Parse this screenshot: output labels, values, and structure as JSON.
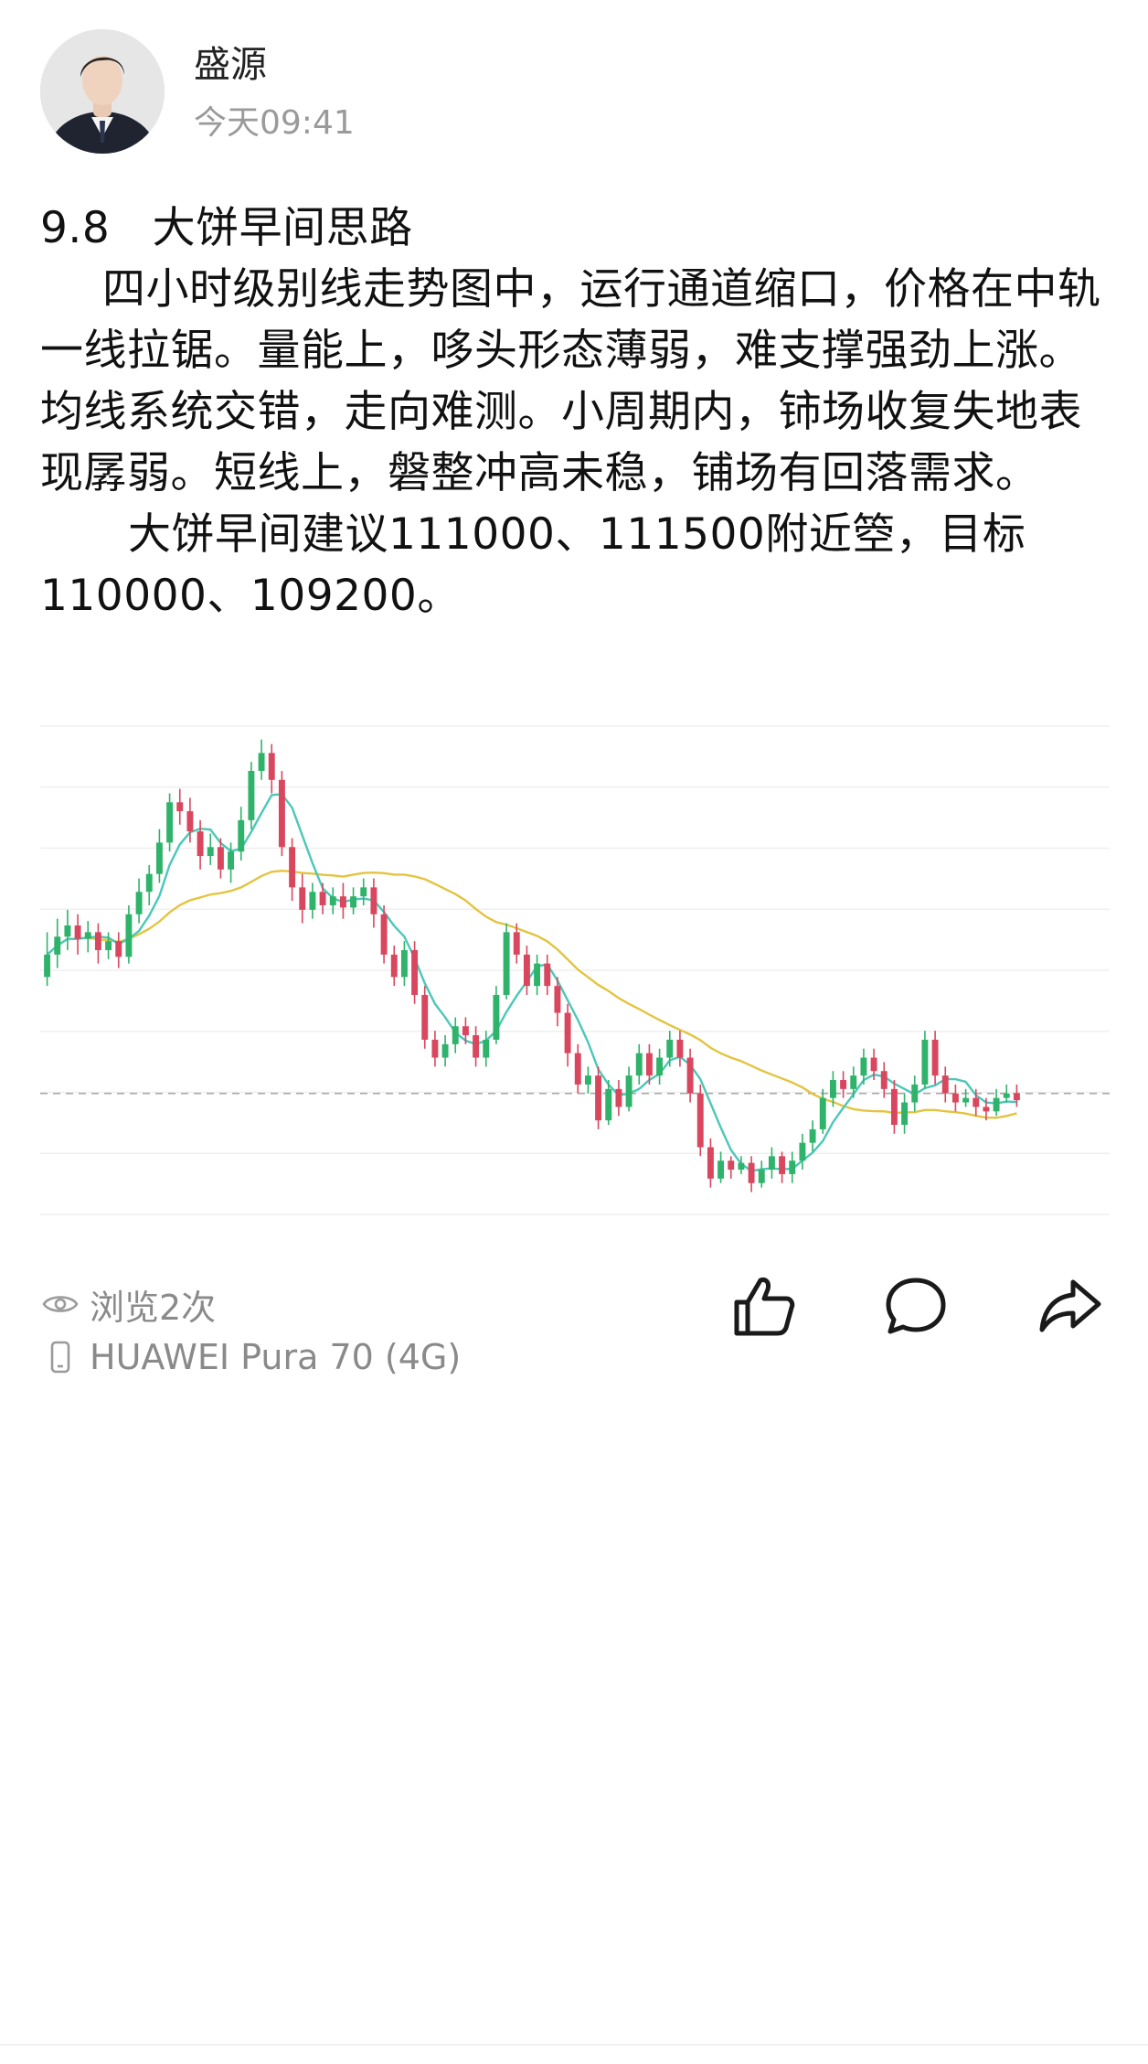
{
  "author": {
    "name": "盛源",
    "time": "今天09:41"
  },
  "post": {
    "title": "9.8   大饼早间思路",
    "paragraph1": "四小时级别线走势图中，运行通道缩口，价格在中轨一线拉锯。量能上，哆头形态薄弱，难支撑强劲上涨。均线系统交错，走向难测。小周期内，铈场收复失地表现孱弱。短线上，磐整冲高未稳，铺场有回落需求。",
    "paragraph2": "大饼早间建议111000、111500附近箜，目标110000、109200。"
  },
  "chart_data": {
    "type": "candlestick",
    "colors": {
      "up": "#2fb36b",
      "down": "#d9475f",
      "ma_short": "#4cc7b8",
      "ma_long": "#e3c440",
      "price_line": "#aaaaaa",
      "grid": "#efefef"
    },
    "grid": true,
    "candles": [
      [
        140,
        150,
        160,
        136
      ],
      [
        150,
        158,
        166,
        144
      ],
      [
        158,
        163,
        170,
        152
      ],
      [
        163,
        157,
        168,
        150
      ],
      [
        157,
        160,
        165,
        151
      ],
      [
        160,
        152,
        164,
        146
      ],
      [
        152,
        156,
        160,
        148
      ],
      [
        156,
        149,
        160,
        144
      ],
      [
        149,
        168,
        172,
        146
      ],
      [
        168,
        178,
        184,
        164
      ],
      [
        178,
        186,
        190,
        172
      ],
      [
        186,
        200,
        206,
        182
      ],
      [
        200,
        218,
        222,
        196
      ],
      [
        218,
        214,
        224,
        208
      ],
      [
        214,
        205,
        220,
        200
      ],
      [
        205,
        194,
        210,
        188
      ],
      [
        194,
        198,
        204,
        190
      ],
      [
        198,
        188,
        202,
        184
      ],
      [
        188,
        196,
        200,
        182
      ],
      [
        196,
        210,
        216,
        192
      ],
      [
        210,
        232,
        236,
        206
      ],
      [
        232,
        240,
        246,
        228
      ],
      [
        240,
        228,
        244,
        222
      ],
      [
        228,
        198,
        232,
        194
      ],
      [
        198,
        180,
        202,
        174
      ],
      [
        180,
        170,
        186,
        164
      ],
      [
        170,
        178,
        182,
        166
      ],
      [
        178,
        172,
        182,
        168
      ],
      [
        172,
        176,
        180,
        168
      ],
      [
        176,
        171,
        182,
        166
      ],
      [
        171,
        176,
        180,
        168
      ],
      [
        176,
        180,
        184,
        172
      ],
      [
        180,
        168,
        184,
        162
      ],
      [
        168,
        150,
        172,
        146
      ],
      [
        150,
        140,
        154,
        136
      ],
      [
        140,
        152,
        156,
        136
      ],
      [
        152,
        132,
        156,
        128
      ],
      [
        132,
        112,
        136,
        108
      ],
      [
        112,
        104,
        116,
        100
      ],
      [
        104,
        110,
        114,
        100
      ],
      [
        110,
        118,
        122,
        106
      ],
      [
        118,
        114,
        122,
        110
      ],
      [
        114,
        104,
        118,
        100
      ],
      [
        104,
        112,
        116,
        100
      ],
      [
        112,
        132,
        136,
        110
      ],
      [
        132,
        160,
        164,
        130
      ],
      [
        160,
        150,
        164,
        146
      ],
      [
        150,
        136,
        154,
        132
      ],
      [
        136,
        146,
        150,
        132
      ],
      [
        146,
        136,
        150,
        132
      ],
      [
        136,
        124,
        140,
        118
      ],
      [
        124,
        106,
        128,
        100
      ],
      [
        106,
        92,
        110,
        88
      ],
      [
        92,
        96,
        100,
        88
      ],
      [
        96,
        76,
        100,
        72
      ],
      [
        76,
        90,
        94,
        74
      ],
      [
        90,
        82,
        94,
        78
      ],
      [
        82,
        96,
        100,
        80
      ],
      [
        96,
        106,
        110,
        92
      ],
      [
        106,
        96,
        110,
        92
      ],
      [
        96,
        104,
        108,
        92
      ],
      [
        104,
        112,
        116,
        100
      ],
      [
        112,
        104,
        116,
        100
      ],
      [
        104,
        88,
        108,
        84
      ],
      [
        88,
        64,
        92,
        60
      ],
      [
        64,
        50,
        68,
        46
      ],
      [
        50,
        58,
        62,
        48
      ],
      [
        58,
        54,
        60,
        50
      ],
      [
        54,
        57,
        60,
        52
      ],
      [
        57,
        48,
        60,
        44
      ],
      [
        48,
        54,
        58,
        46
      ],
      [
        54,
        60,
        64,
        50
      ],
      [
        60,
        52,
        62,
        48
      ],
      [
        52,
        58,
        62,
        48
      ],
      [
        58,
        66,
        70,
        54
      ],
      [
        66,
        72,
        76,
        62
      ],
      [
        72,
        86,
        90,
        70
      ],
      [
        86,
        94,
        98,
        82
      ],
      [
        94,
        90,
        98,
        86
      ],
      [
        90,
        96,
        100,
        86
      ],
      [
        96,
        104,
        108,
        92
      ],
      [
        104,
        98,
        108,
        94
      ],
      [
        98,
        90,
        102,
        86
      ],
      [
        90,
        74,
        94,
        70
      ],
      [
        74,
        84,
        88,
        70
      ],
      [
        84,
        92,
        96,
        80
      ],
      [
        92,
        112,
        116,
        90
      ],
      [
        112,
        96,
        116,
        92
      ],
      [
        96,
        88,
        100,
        84
      ],
      [
        88,
        84,
        92,
        80
      ],
      [
        84,
        86,
        90,
        82
      ],
      [
        86,
        82,
        90,
        78
      ],
      [
        82,
        80,
        86,
        76
      ],
      [
        80,
        86,
        90,
        78
      ],
      [
        86,
        88,
        92,
        84
      ],
      [
        88,
        85,
        92,
        82
      ]
    ],
    "price_line": 88
  },
  "stats": {
    "views": "浏览2次",
    "device": "HUAWEI Pura 70 (4G)"
  },
  "icons": {
    "views": "eye-icon",
    "device": "phone-icon",
    "like": "thumbs-up-icon",
    "comment": "comment-icon",
    "share": "share-icon"
  }
}
